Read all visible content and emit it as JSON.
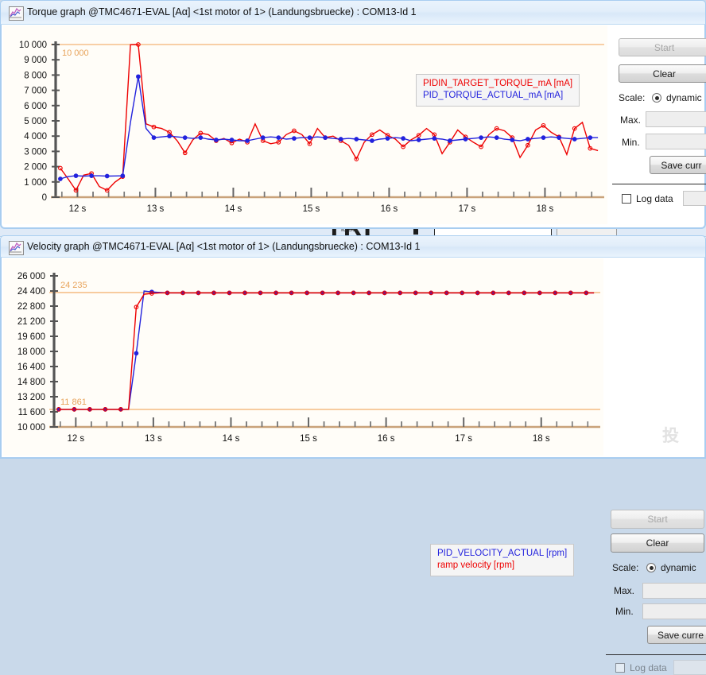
{
  "torque_window": {
    "title": "Torque graph @TMC4671-EVAL [Aα] <1st motor of 1> (Landungsbruecke) : COM13-Id 1",
    "icon": "chart-icon",
    "legend": {
      "series1": "PIDIN_TARGET_TORQUE_mA [mA]",
      "series2": "PID_TORQUE_ACTUAL_mA [mA]"
    },
    "controls": {
      "start_label": "Start",
      "clear_label": "Clear",
      "scale_label": "Scale:",
      "scale_value": "dynamic",
      "max_label": "Max.",
      "max_value": "",
      "min_label": "Min.",
      "min_value": "",
      "save_label": "Save curr",
      "log_label": "Log data",
      "log_value": ""
    }
  },
  "velocity_window": {
    "title": "Velocity graph @TMC4671-EVAL [Aα] <1st motor of 1> (Landungsbruecke) : COM13-Id 1",
    "icon": "chart-icon",
    "legend": {
      "series1": "PID_VELOCITY_ACTUAL [rpm]",
      "series2": "ramp velocity [rpm]"
    },
    "controls": {
      "start_label": "Start",
      "clear_label": "Clear",
      "scale_label": "Scale:",
      "scale_value": "dynamic",
      "max_label": "Max.",
      "max_value": "",
      "min_label": "Min.",
      "min_value": "",
      "save_label": "Save curre",
      "log_label": "Log data",
      "log_value": ""
    }
  },
  "background_window": {
    "logo_text": "TRI",
    "watermark": "投"
  },
  "colors": {
    "series_red": "#ee0000",
    "series_blue": "#2222dd",
    "marker_line": "#f5c08a",
    "axis": "#555555",
    "baseline": "#c9a27a",
    "plot_bg": "#fffdf8",
    "titlebar": "#e2eefa",
    "window_border": "#a8cdf0",
    "desktop": "#c9d9ea"
  },
  "chart_data": [
    {
      "type": "line",
      "name": "torque-graph",
      "title": "Torque graph",
      "xlabel": "",
      "ylabel": "",
      "xlim": [
        11.72,
        18.72
      ],
      "ylim": [
        0,
        10000
      ],
      "ytick_labels": [
        "10 000",
        "9 000",
        "8 000",
        "7 000",
        "6 000",
        "5 000",
        "4 000",
        "3 000",
        "2 000",
        "1 000",
        "0"
      ],
      "yticks": [
        10000,
        9000,
        8000,
        7000,
        6000,
        5000,
        4000,
        3000,
        2000,
        1000,
        0
      ],
      "xtick_labels": [
        "12 s",
        "13 s",
        "14 s",
        "15 s",
        "16 s",
        "17 s",
        "18 s"
      ],
      "xticks": [
        12,
        13,
        14,
        15,
        16,
        17,
        18
      ],
      "minor_xticks_per_major": 5,
      "grid": false,
      "legend_position": "inside-top-right",
      "marker_lines": [
        {
          "value": 10000,
          "label": "10 000",
          "color": "#f5c08a"
        }
      ],
      "x": [
        11.78,
        11.88,
        11.98,
        12.08,
        12.18,
        12.28,
        12.38,
        12.48,
        12.58,
        12.68,
        12.78,
        12.88,
        12.98,
        13.08,
        13.18,
        13.28,
        13.38,
        13.48,
        13.58,
        13.68,
        13.78,
        13.88,
        13.98,
        14.08,
        14.18,
        14.28,
        14.38,
        14.48,
        14.58,
        14.68,
        14.78,
        14.88,
        14.98,
        15.08,
        15.18,
        15.28,
        15.38,
        15.48,
        15.58,
        15.68,
        15.78,
        15.88,
        15.98,
        16.08,
        16.18,
        16.28,
        16.38,
        16.48,
        16.58,
        16.68,
        16.78,
        16.88,
        16.98,
        17.08,
        17.18,
        17.28,
        17.38,
        17.48,
        17.58,
        17.68,
        17.78,
        17.88,
        17.98,
        18.08,
        18.18,
        18.28,
        18.38,
        18.48,
        18.58,
        18.68
      ],
      "series": [
        {
          "name": "PIDIN_TARGET_TORQUE_mA [mA]",
          "color": "#ee0000",
          "values": [
            1900,
            1200,
            450,
            1450,
            1550,
            700,
            450,
            980,
            1350,
            9990,
            10000,
            4800,
            4600,
            4500,
            4250,
            3700,
            2900,
            3750,
            4200,
            4100,
            3700,
            3850,
            3550,
            3800,
            3600,
            4800,
            3700,
            3500,
            3600,
            4100,
            4350,
            4100,
            3500,
            4500,
            3900,
            4000,
            3700,
            3400,
            2500,
            3600,
            4100,
            4400,
            4050,
            3800,
            3300,
            3750,
            4050,
            4500,
            4100,
            2850,
            3600,
            4400,
            3950,
            3600,
            3300,
            4100,
            4500,
            4350,
            3900,
            2600,
            3400,
            4400,
            4700,
            4250,
            3950,
            2800,
            4500,
            4900,
            3200,
            3050
          ]
        },
        {
          "name": "PID_TORQUE_ACTUAL_mA [mA]",
          "color": "#2222dd",
          "values": [
            1200,
            1350,
            1400,
            1380,
            1400,
            1400,
            1380,
            1390,
            1400,
            4900,
            7900,
            4500,
            3900,
            3950,
            4000,
            3950,
            3900,
            3850,
            3900,
            3800,
            3750,
            3800,
            3750,
            3700,
            3700,
            3800,
            3900,
            3950,
            3900,
            3800,
            3850,
            3900,
            3900,
            3950,
            3900,
            3850,
            3800,
            3850,
            3800,
            3750,
            3700,
            3800,
            3850,
            3900,
            3850,
            3700,
            3750,
            3800,
            3850,
            3800,
            3700,
            3750,
            3800,
            3850,
            3900,
            3950,
            3900,
            3800,
            3750,
            3700,
            3800,
            3850,
            3900,
            3950,
            3900,
            3850,
            3800,
            3850,
            3900,
            3900
          ]
        }
      ]
    },
    {
      "type": "line",
      "name": "velocity-graph",
      "title": "Velocity graph",
      "xlabel": "",
      "ylabel": "",
      "xlim": [
        11.72,
        18.72
      ],
      "ylim": [
        10000,
        26000
      ],
      "ytick_labels": [
        "26 000",
        "24 400",
        "22 800",
        "21 200",
        "19 600",
        "18 000",
        "16 400",
        "14 800",
        "13 200",
        "11 600",
        "10 000"
      ],
      "yticks": [
        26000,
        24400,
        22800,
        21200,
        19600,
        18000,
        16400,
        14800,
        13200,
        11600,
        10000
      ],
      "xtick_labels": [
        "12 s",
        "13 s",
        "14 s",
        "15 s",
        "16 s",
        "17 s",
        "18 s"
      ],
      "xticks": [
        12,
        13,
        14,
        15,
        16,
        17,
        18
      ],
      "minor_xticks_per_major": 5,
      "grid": false,
      "legend_position": "inside-middle-right",
      "marker_lines": [
        {
          "value": 24235,
          "label": "24 235",
          "color": "#f5c08a"
        },
        {
          "value": 11861,
          "label": "11 861",
          "color": "#f5c08a"
        }
      ],
      "x": [
        11.78,
        11.88,
        11.98,
        12.08,
        12.18,
        12.28,
        12.38,
        12.48,
        12.58,
        12.68,
        12.78,
        12.88,
        12.98,
        13.08,
        13.18,
        13.28,
        13.38,
        13.48,
        13.58,
        13.68,
        13.78,
        13.88,
        13.98,
        14.08,
        14.18,
        14.28,
        14.38,
        14.48,
        14.58,
        14.68,
        14.78,
        14.88,
        14.98,
        15.08,
        15.18,
        15.28,
        15.38,
        15.48,
        15.58,
        15.68,
        15.78,
        15.88,
        15.98,
        16.08,
        16.18,
        16.28,
        16.38,
        16.48,
        16.58,
        16.68,
        16.78,
        16.88,
        16.98,
        17.08,
        17.18,
        17.28,
        17.38,
        17.48,
        17.58,
        17.68,
        17.78,
        17.88,
        17.98,
        18.08,
        18.18,
        18.28,
        18.38,
        18.48,
        18.58,
        18.68
      ],
      "series": [
        {
          "name": "PID_VELOCITY_ACTUAL [rpm]",
          "color": "#2222dd",
          "values": [
            11861,
            11861,
            11861,
            11861,
            11861,
            11861,
            11861,
            11861,
            11861,
            11861,
            17800,
            24400,
            24300,
            24250,
            24200,
            24200,
            24200,
            24200,
            24200,
            24200,
            24200,
            24200,
            24200,
            24200,
            24200,
            24200,
            24200,
            24200,
            24200,
            24200,
            24200,
            24200,
            24200,
            24200,
            24200,
            24200,
            24200,
            24200,
            24200,
            24200,
            24200,
            24200,
            24200,
            24200,
            24200,
            24200,
            24200,
            24200,
            24200,
            24200,
            24200,
            24200,
            24200,
            24200,
            24200,
            24200,
            24200,
            24200,
            24200,
            24200,
            24200,
            24200,
            24200,
            24200,
            24200,
            24200,
            24200,
            24200,
            24200,
            24200
          ]
        },
        {
          "name": "ramp velocity [rpm]",
          "color": "#ee0000",
          "values": [
            11861,
            11861,
            11861,
            11861,
            11861,
            11861,
            11861,
            11861,
            11861,
            11861,
            22700,
            24050,
            24150,
            24200,
            24200,
            24200,
            24200,
            24200,
            24200,
            24200,
            24200,
            24200,
            24200,
            24200,
            24200,
            24200,
            24200,
            24200,
            24200,
            24200,
            24200,
            24200,
            24200,
            24200,
            24200,
            24200,
            24200,
            24200,
            24200,
            24200,
            24200,
            24200,
            24200,
            24200,
            24200,
            24200,
            24200,
            24200,
            24200,
            24200,
            24200,
            24200,
            24200,
            24200,
            24200,
            24200,
            24200,
            24200,
            24200,
            24200,
            24200,
            24200,
            24200,
            24200,
            24200,
            24200,
            24200,
            24200,
            24200,
            24200
          ]
        }
      ]
    }
  ]
}
